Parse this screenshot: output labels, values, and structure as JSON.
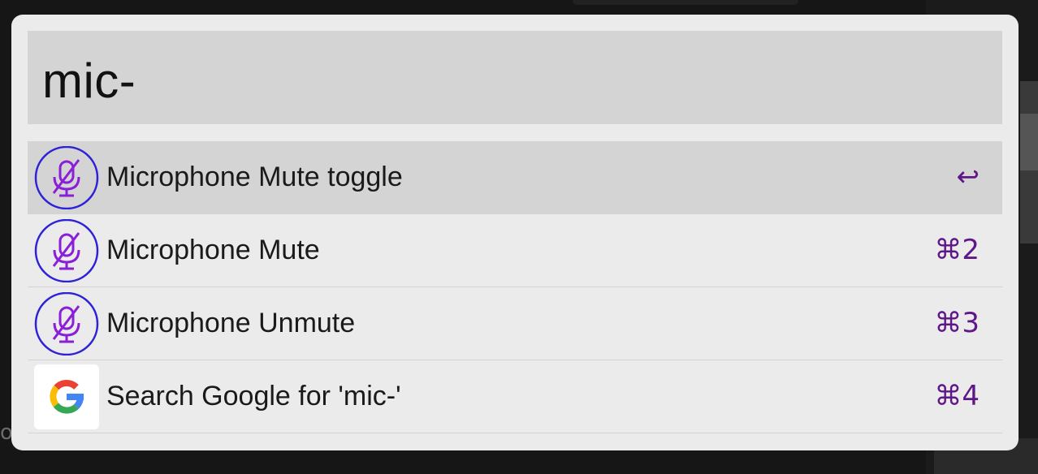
{
  "search": {
    "query": "mic-"
  },
  "results": [
    {
      "label": "Microphone Mute toggle",
      "shortcut": "↩",
      "icon": "mic-mute-icon",
      "selected": true
    },
    {
      "label": "Microphone Mute",
      "shortcut": "⌘2",
      "icon": "mic-mute-icon",
      "selected": false
    },
    {
      "label": "Microphone Unmute",
      "shortcut": "⌘3",
      "icon": "mic-mute-icon",
      "selected": false
    },
    {
      "label": "Search Google for 'mic-'",
      "shortcut": "⌘4",
      "icon": "google-icon",
      "selected": false
    }
  ],
  "background": {
    "edge_char": "o"
  },
  "colors": {
    "shortcut": "#5f1788",
    "mic_ring": "#2e22d6",
    "mic_glyph": "#8a1fd8",
    "panel": "#ebebeb",
    "selected_row": "#d4d4d4"
  }
}
